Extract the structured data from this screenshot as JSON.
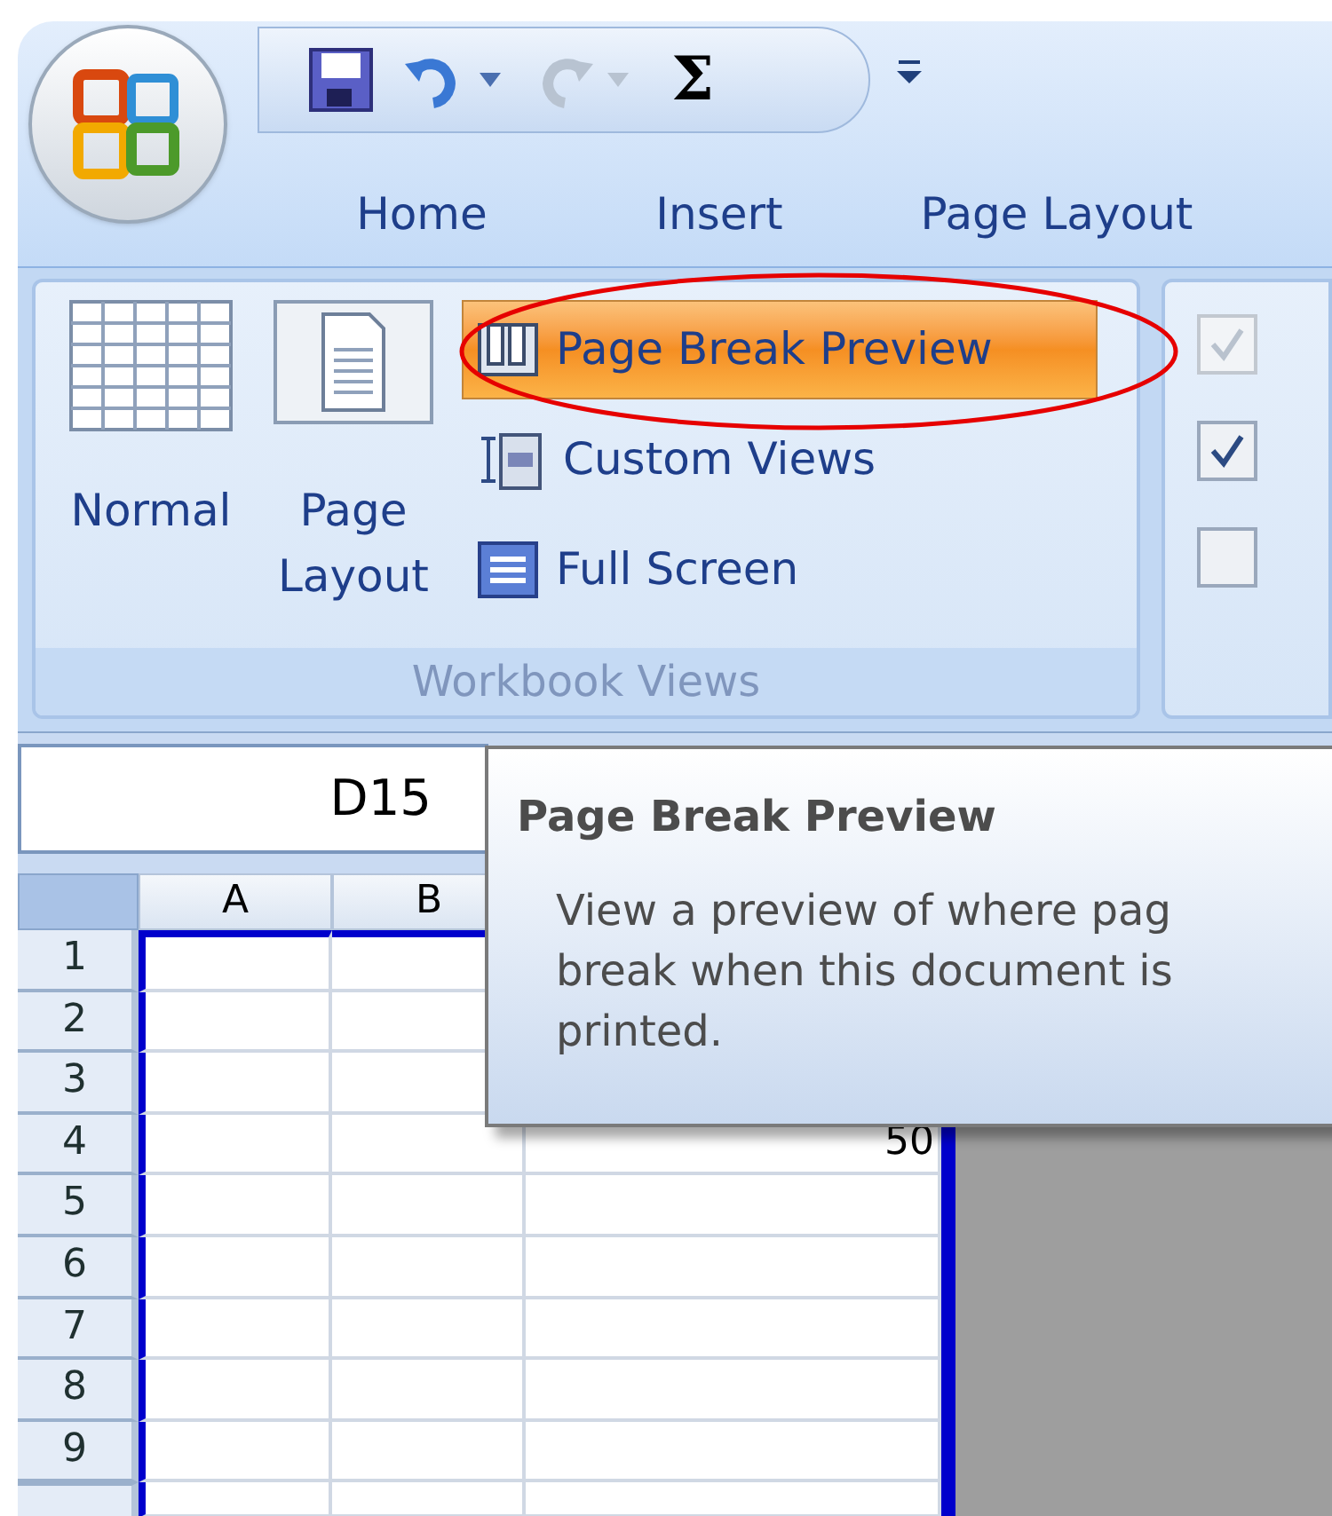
{
  "quick_access": {
    "autosum_symbol": "Σ"
  },
  "tabs": [
    {
      "label": "Home"
    },
    {
      "label": "Insert"
    },
    {
      "label": "Page Layout"
    }
  ],
  "ribbon_group": {
    "label": "Workbook Views",
    "large_buttons": [
      {
        "kind": "normal",
        "label": "Normal"
      },
      {
        "kind": "page_layout",
        "label": "Page Layout"
      }
    ],
    "small_buttons": [
      {
        "kind": "page_break",
        "label": "Page Break Preview",
        "highlighted": true
      },
      {
        "kind": "custom_views",
        "label": "Custom Views",
        "highlighted": false
      },
      {
        "kind": "full_screen",
        "label": "Full Screen",
        "highlighted": false
      }
    ]
  },
  "show_hide_checkboxes": [
    {
      "checked": true,
      "disabled": true
    },
    {
      "checked": true,
      "disabled": false
    },
    {
      "checked": false,
      "disabled": false
    }
  ],
  "name_box": {
    "value": "D15"
  },
  "sheet": {
    "columns": [
      "A",
      "B"
    ],
    "rows": [
      {
        "label": "1"
      },
      {
        "label": "2"
      },
      {
        "label": "3"
      },
      {
        "label": "4",
        "column_3": "50"
      },
      {
        "label": "5"
      },
      {
        "label": "6"
      },
      {
        "label": "7"
      },
      {
        "label": "8"
      },
      {
        "label": "9"
      }
    ]
  },
  "tooltip": {
    "title": "Page Break Preview",
    "lines": [
      "View a preview of where pag",
      "break when this document is",
      "printed."
    ]
  }
}
